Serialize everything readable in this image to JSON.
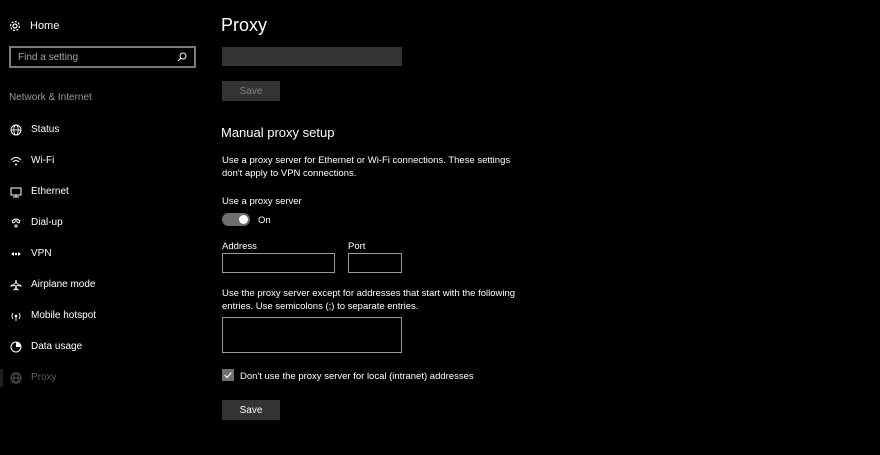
{
  "sidebar": {
    "home_label": "Home",
    "search_placeholder": "Find a setting",
    "section_label": "Network & Internet",
    "items": [
      {
        "label": "Status",
        "icon": "globe-icon"
      },
      {
        "label": "Wi-Fi",
        "icon": "wifi-icon"
      },
      {
        "label": "Ethernet",
        "icon": "ethernet-icon"
      },
      {
        "label": "Dial-up",
        "icon": "phone-icon"
      },
      {
        "label": "VPN",
        "icon": "vpn-icon"
      },
      {
        "label": "Airplane mode",
        "icon": "airplane-icon"
      },
      {
        "label": "Mobile hotspot",
        "icon": "hotspot-icon"
      },
      {
        "label": "Data usage",
        "icon": "data-usage-icon"
      },
      {
        "label": "Proxy",
        "icon": "globe-icon"
      }
    ]
  },
  "main": {
    "title": "Proxy",
    "script_save_label": "Save",
    "manual_title": "Manual proxy setup",
    "manual_desc": "Use a proxy server for Ethernet or Wi-Fi connections. These settings don't apply to VPN connections.",
    "use_proxy_label": "Use a proxy server",
    "toggle_state": "On",
    "address_label": "Address",
    "address_value": "",
    "port_label": "Port",
    "port_value": "",
    "exceptions_desc": "Use the proxy server except for addresses that start with the following entries. Use semicolons (;) to separate entries.",
    "exceptions_value": "",
    "local_checkbox_label": "Don't use the proxy server for local (intranet) addresses",
    "local_checked": true,
    "save_label": "Save"
  },
  "colors": {
    "background": "#000000",
    "toggle_on": "#6f6f6f",
    "disabled_button": "#333333"
  }
}
